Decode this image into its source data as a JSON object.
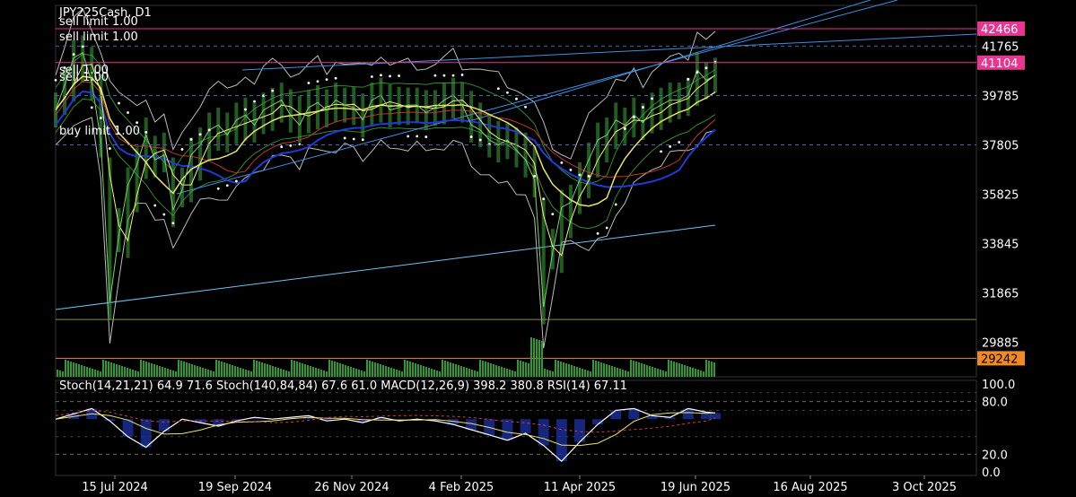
{
  "chart_data": [
    {
      "type": "line",
      "symbol": "JPY225Cash",
      "timeframe": "D1",
      "title": "JPY225Cash, D1",
      "y_axis": {
        "ticks": [
          41765,
          39785,
          37805,
          35825,
          33845,
          31865,
          29885
        ],
        "range": [
          28500,
          43400
        ]
      },
      "x_axis": {
        "ticks": [
          "15 Jul 2024",
          "19 Sep 2024",
          "26 Nov 2024",
          "4 Feb 2025",
          "11 Apr 2025",
          "19 Jun 2025",
          "16 Aug 2025",
          "3 Oct 2025"
        ]
      },
      "price_tags": [
        {
          "value": 42466,
          "color": "#e8358f"
        },
        {
          "value": 41104,
          "color": "#e8358f"
        },
        {
          "value": 29242,
          "color": "#f08a24"
        }
      ],
      "order_labels": [
        "sell limit 1.00",
        "sell limit 1.00",
        "sell 1.00",
        "sell 1.00",
        "buy limit 1.00"
      ],
      "series": [
        {
          "name": "price",
          "x": [
            0,
            10,
            20,
            30,
            40,
            50,
            60,
            70,
            80,
            90,
            100,
            110,
            120,
            130,
            140,
            150,
            160,
            170,
            180,
            190,
            200,
            210,
            220,
            230,
            240,
            250,
            260,
            270,
            280,
            290,
            300,
            310,
            320,
            330,
            340,
            350,
            360,
            370,
            380,
            390,
            400,
            410,
            420,
            430,
            440,
            450,
            460,
            470,
            480,
            490,
            500,
            510,
            520,
            530,
            540,
            550,
            560,
            570,
            580,
            590,
            600,
            610,
            620,
            630,
            640,
            650,
            660,
            670,
            680,
            690,
            700,
            710,
            720,
            730
          ],
          "y": [
            39200,
            40200,
            41300,
            41500,
            40300,
            38000,
            31500,
            34200,
            36200,
            37000,
            38200,
            37200,
            37400,
            35200,
            36000,
            37400,
            37800,
            38400,
            38600,
            38200,
            38800,
            39000,
            38600,
            39200,
            39400,
            39600,
            39000,
            38600,
            39300,
            39500,
            39200,
            39600,
            39400,
            39300,
            38800,
            39600,
            39800,
            39200,
            39300,
            39400,
            39400,
            39100,
            39300,
            39600,
            39800,
            39400,
            38600,
            38400,
            38000,
            37800,
            38000,
            37600,
            37200,
            36400,
            31300,
            33500,
            35300,
            35500,
            36400,
            37200,
            38000,
            38200,
            38800,
            38600,
            39000,
            38700,
            39200,
            39400,
            39600,
            39600,
            39800,
            40800,
            40400,
            40600
          ]
        }
      ]
    },
    {
      "type": "line",
      "title": "Stoch(14,21,21) 64.9 71.6 Stoch(140,84,84) 67.6 61.0 MACD(12,26,9) 398.2 380.8 RSI(14) 67.11",
      "y_axis": {
        "ticks": [
          "100.0",
          "80.0",
          "20.0",
          "0.0"
        ],
        "range": [
          0,
          100
        ]
      },
      "series": [
        {
          "name": "RSI(14)",
          "x": [
            0,
            20,
            40,
            60,
            80,
            100,
            120,
            140,
            160,
            180,
            200,
            220,
            240,
            260,
            280,
            300,
            320,
            340,
            360,
            380,
            400,
            420,
            440,
            460,
            480,
            500,
            520,
            540,
            560,
            580,
            600,
            620,
            640,
            660,
            680,
            700,
            720,
            730
          ],
          "y": [
            60,
            66,
            72,
            58,
            40,
            28,
            46,
            60,
            56,
            52,
            58,
            62,
            60,
            62,
            64,
            58,
            60,
            56,
            62,
            58,
            60,
            58,
            54,
            48,
            42,
            36,
            44,
            30,
            12,
            34,
            54,
            70,
            72,
            64,
            62,
            72,
            68,
            67
          ]
        }
      ]
    }
  ]
}
